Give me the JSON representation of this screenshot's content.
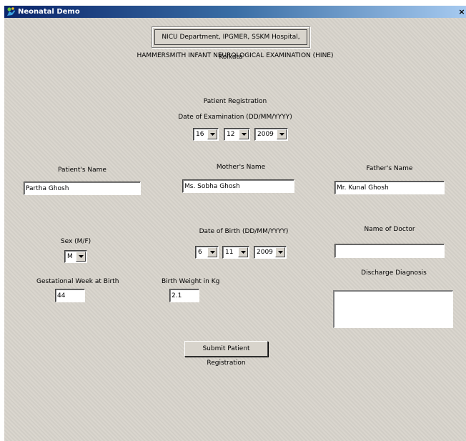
{
  "window": {
    "title": "Neonatal Demo",
    "close_glyph": "×",
    "app_icon": "neonatal-app-icon",
    "close_icon": "close-icon"
  },
  "header": {
    "department": "NICU Department, IPGMER, SSKM Hospital, Kolkata",
    "exam_title": "HAMMERSMITH INFANT NEUROLOGICAL EXAMINATION (HINE)"
  },
  "registration": {
    "section_title": "Patient Registration",
    "exam_date_label": "Date of Examination (DD/MM/YYYY)",
    "exam_day": "16",
    "exam_month": "12",
    "exam_year": "2009",
    "patient_name_label": "Patient's Name",
    "patient_name": "Partha Ghosh",
    "mother_name_label": "Mother's Name",
    "mother_name": "Ms. Sobha Ghosh",
    "father_name_label": "Father's Name",
    "father_name": "Mr. Kunal Ghosh",
    "sex_label": "Sex (M/F)",
    "sex": "M",
    "dob_label": "Date of Birth (DD/MM/YYYY)",
    "dob_day": "6",
    "dob_month": "11",
    "dob_year": "2009",
    "doctor_label": "Name of Doctor",
    "doctor_name": "",
    "gest_week_label": "Gestational Week at Birth",
    "gest_week": "44",
    "birth_weight_label": "Birth Weight in Kg",
    "birth_weight": "2.1",
    "discharge_label": "Discharge Diagnosis",
    "discharge_diagnosis": "",
    "submit_label": "Submit Patient Registration"
  },
  "colors": {
    "window_bg": "#d8d4cc",
    "titlebar_start": "#0a246a",
    "titlebar_end": "#a6caf0"
  }
}
